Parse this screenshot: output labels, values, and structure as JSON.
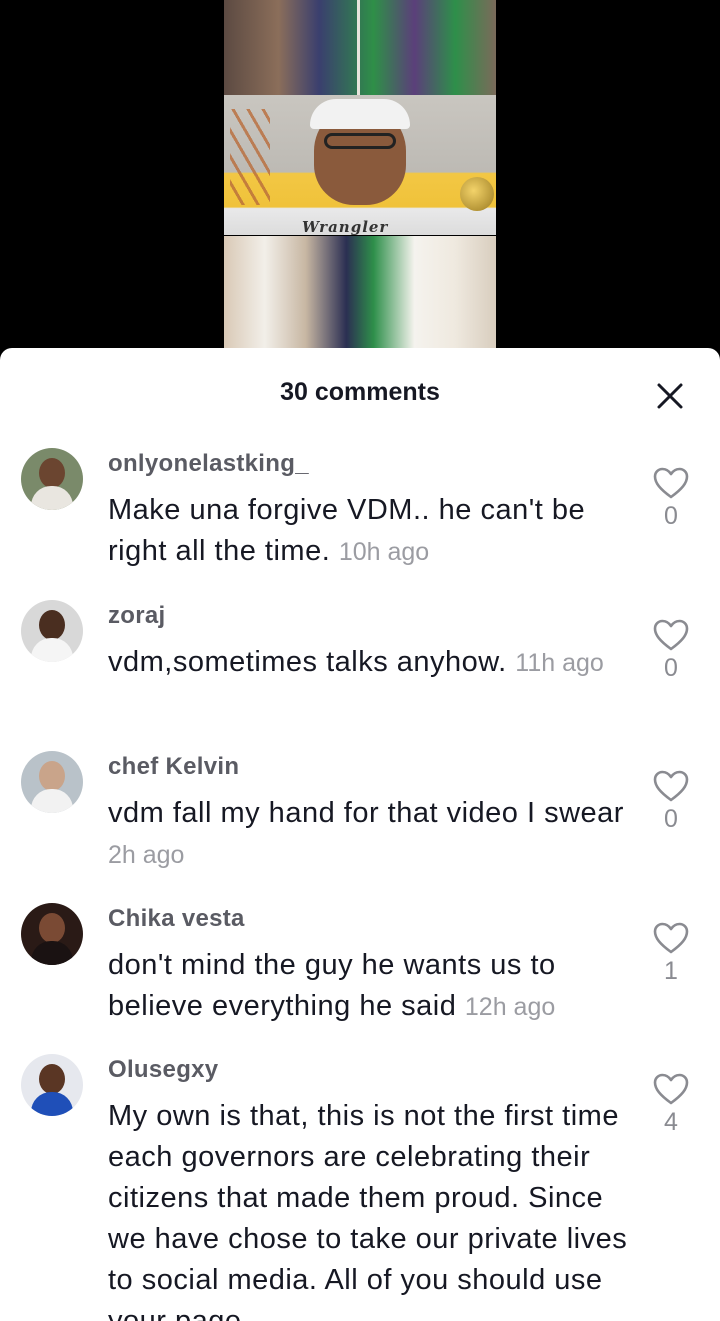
{
  "colors": {
    "sheet_bg": "#ffffff",
    "text_primary": "#161823",
    "text_secondary": "#5a5b63",
    "timestamp": "#9b9ca2",
    "like_count": "#8a8b91"
  },
  "header": {
    "comment_count": "30 comments",
    "close_icon": "close-icon"
  },
  "video": {
    "brand_text": "Wrangler"
  },
  "comments": [
    {
      "username": "onlyonelastking_",
      "text": "Make una forgive VDM.. he can't be right all the time.",
      "time": "10h ago",
      "likes": "0",
      "icon": "heart-outline-icon"
    },
    {
      "username": "zoraj",
      "text": "vdm,sometimes talks anyhow.",
      "time": "11h ago",
      "likes": "0",
      "icon": "heart-outline-icon"
    },
    {
      "username": "chef Kelvin",
      "text": "vdm fall my hand for that video I swear",
      "time": "2h ago",
      "likes": "0",
      "icon": "heart-outline-icon"
    },
    {
      "username": "Chika vesta",
      "text": "don't mind the guy he wants us to believe everything he said",
      "time": "12h ago",
      "likes": "1",
      "icon": "heart-outline-icon"
    },
    {
      "username": "Olusegxy",
      "text": "My own is that, this is not the first time each governors are celebrating their citizens that made them proud. Since we have chose to take our private lives to social media. All of you should use your page",
      "time": "",
      "likes": "4",
      "icon": "heart-outline-icon"
    }
  ]
}
